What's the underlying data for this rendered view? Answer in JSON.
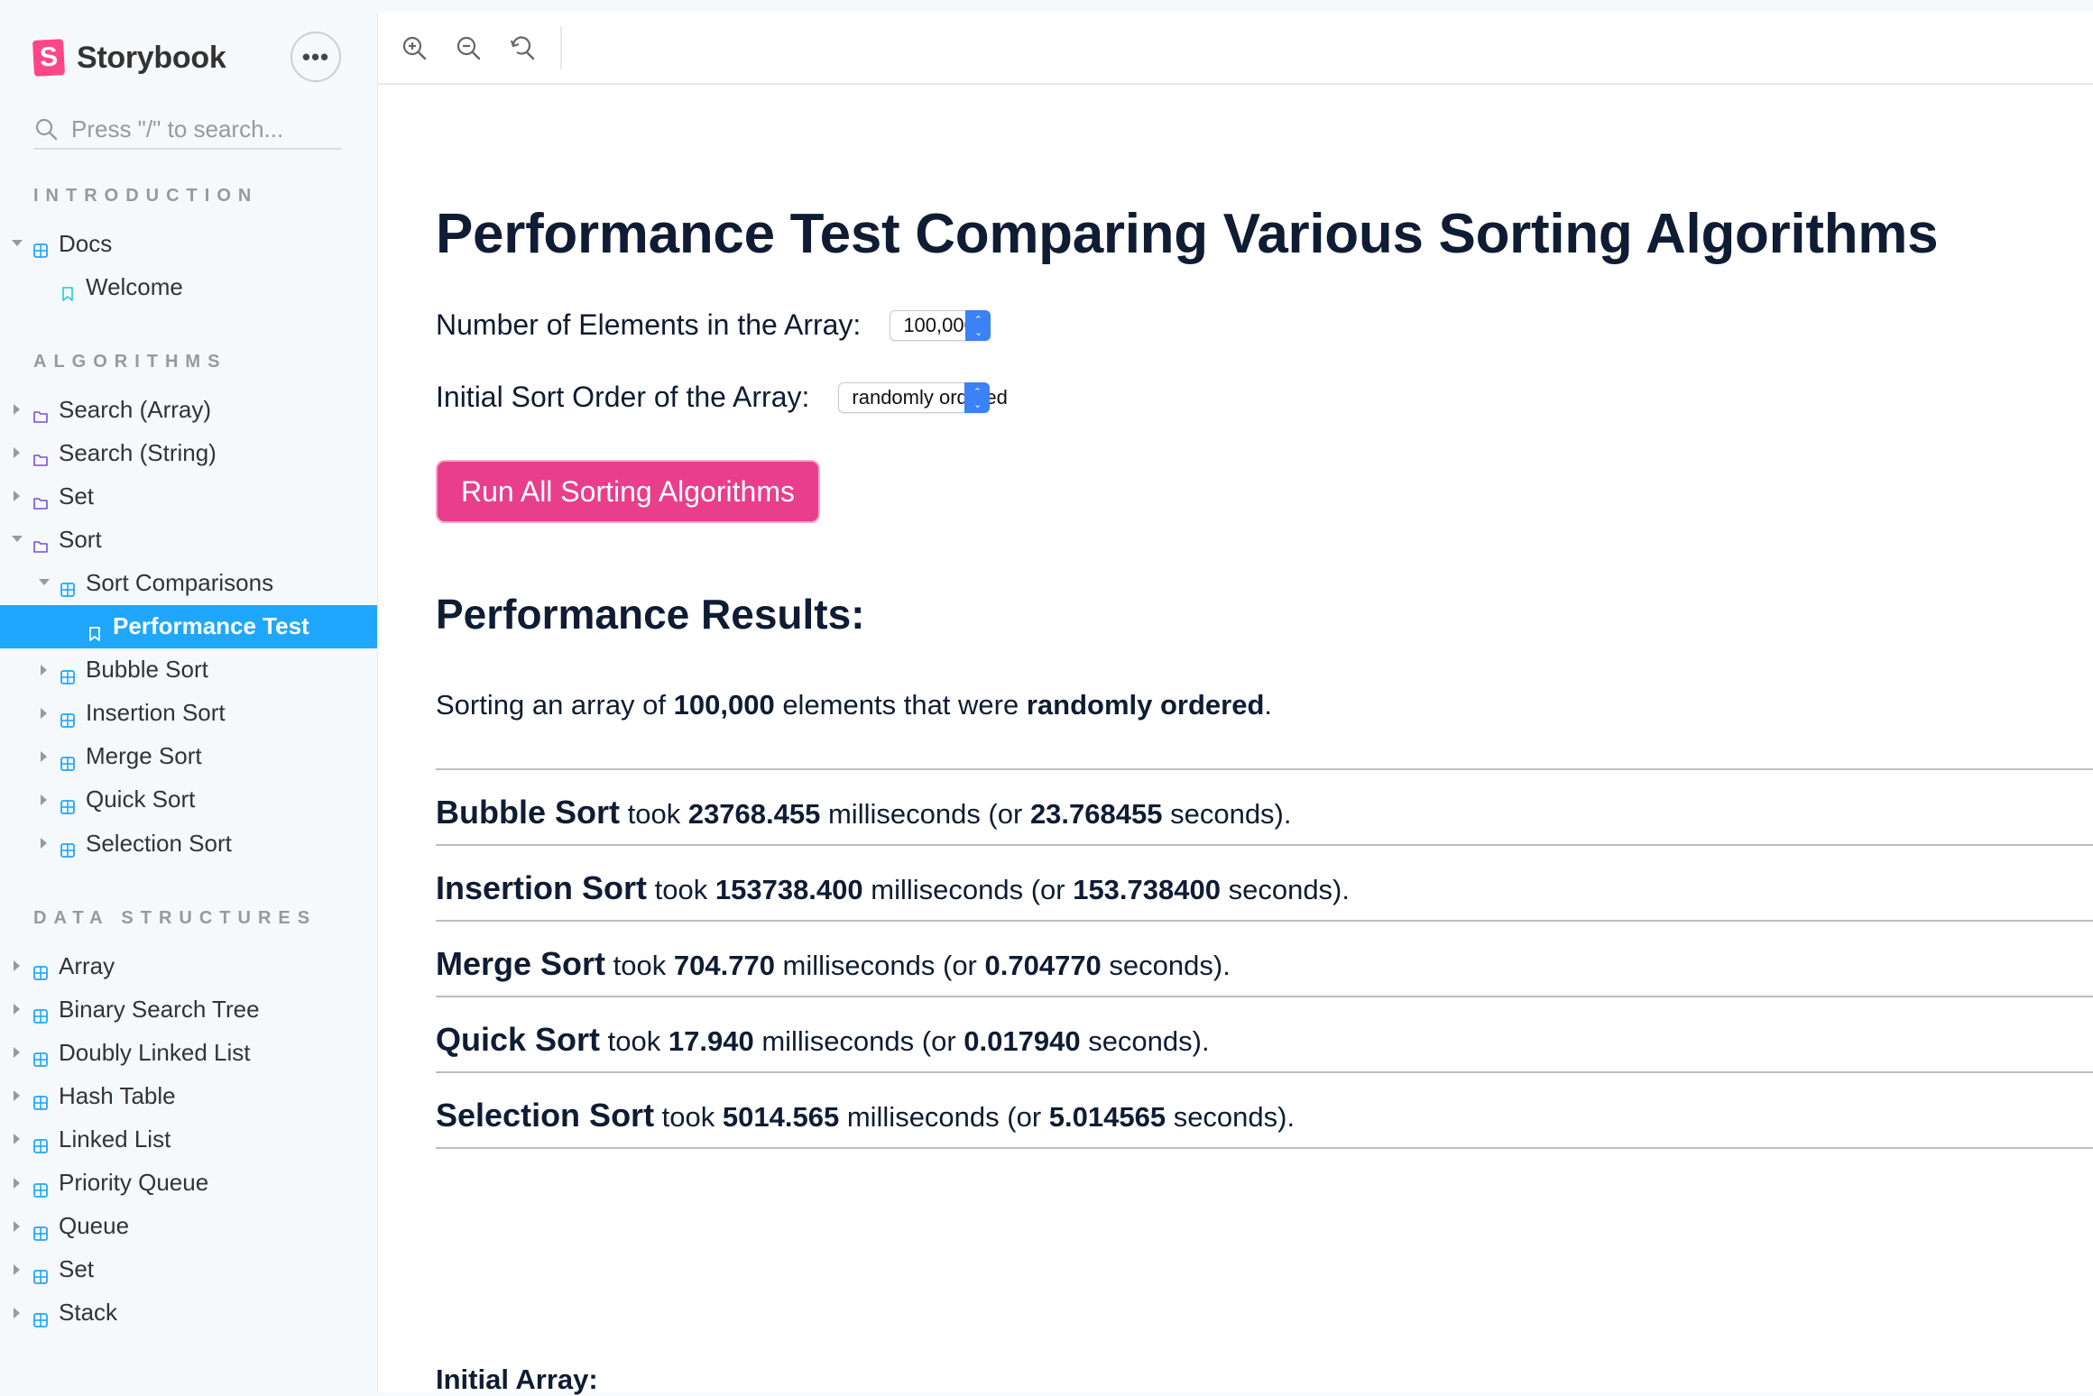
{
  "brand": {
    "logo_letter": "S",
    "name": "Storybook"
  },
  "sidebar": {
    "more_label": "•••",
    "search_placeholder": "Press \"/\" to search...",
    "sections": [
      {
        "heading": "INTRODUCTION",
        "items": [
          {
            "label": "Docs",
            "level": 0,
            "icon": "component-icon",
            "expanded": true
          },
          {
            "label": "Welcome",
            "level": 1,
            "icon": "bookmark-icon"
          }
        ]
      },
      {
        "heading": "ALGORITHMS",
        "items": [
          {
            "label": "Search (Array)",
            "level": 0,
            "icon": "folder-icon",
            "expanded": false
          },
          {
            "label": "Search (String)",
            "level": 0,
            "icon": "folder-icon",
            "expanded": false
          },
          {
            "label": "Set",
            "level": 0,
            "icon": "folder-icon",
            "expanded": false
          },
          {
            "label": "Sort",
            "level": 0,
            "icon": "folder-icon",
            "expanded": true
          },
          {
            "label": "Sort Comparisons",
            "level": 1,
            "icon": "component-icon",
            "expanded": true
          },
          {
            "label": "Performance Test",
            "level": 2,
            "icon": "bookmark-icon",
            "selected": true
          },
          {
            "label": "Bubble Sort",
            "level": 1,
            "icon": "component-icon",
            "expanded": false
          },
          {
            "label": "Insertion Sort",
            "level": 1,
            "icon": "component-icon",
            "expanded": false
          },
          {
            "label": "Merge Sort",
            "level": 1,
            "icon": "component-icon",
            "expanded": false
          },
          {
            "label": "Quick Sort",
            "level": 1,
            "icon": "component-icon",
            "expanded": false
          },
          {
            "label": "Selection Sort",
            "level": 1,
            "icon": "component-icon",
            "expanded": false
          }
        ]
      },
      {
        "heading": "DATA STRUCTURES",
        "items": [
          {
            "label": "Array",
            "level": 0,
            "icon": "component-icon",
            "expanded": false
          },
          {
            "label": "Binary Search Tree",
            "level": 0,
            "icon": "component-icon",
            "expanded": false
          },
          {
            "label": "Doubly Linked List",
            "level": 0,
            "icon": "component-icon",
            "expanded": false
          },
          {
            "label": "Hash Table",
            "level": 0,
            "icon": "component-icon",
            "expanded": false
          },
          {
            "label": "Linked List",
            "level": 0,
            "icon": "component-icon",
            "expanded": false
          },
          {
            "label": "Priority Queue",
            "level": 0,
            "icon": "component-icon",
            "expanded": false
          },
          {
            "label": "Queue",
            "level": 0,
            "icon": "component-icon",
            "expanded": false
          },
          {
            "label": "Set",
            "level": 0,
            "icon": "component-icon",
            "expanded": false
          },
          {
            "label": "Stack",
            "level": 0,
            "icon": "component-icon",
            "expanded": false
          }
        ]
      }
    ]
  },
  "toolbar": {
    "buttons": [
      "zoom-in-icon",
      "zoom-out-icon",
      "reset-zoom-icon"
    ]
  },
  "main": {
    "title": "Performance Test Comparing Various Sorting Algorithms",
    "elements_label": "Number of Elements in the Array:",
    "elements_value": "100,000",
    "order_label": "Initial Sort Order of the Array:",
    "order_value": "randomly ordered",
    "run_button": "Run All Sorting Algorithms",
    "results_heading": "Performance Results:",
    "summary": {
      "prefix": "Sorting an array of ",
      "count": "100,000",
      "middle": " elements that were ",
      "order": "randomly ordered",
      "suffix": "."
    },
    "results": [
      {
        "algo": "Bubble Sort",
        "ms": "23768.455",
        "sec": "23.768455"
      },
      {
        "algo": "Insertion Sort",
        "ms": "153738.400",
        "sec": "153.738400"
      },
      {
        "algo": "Merge Sort",
        "ms": "704.770",
        "sec": "0.704770"
      },
      {
        "algo": "Quick Sort",
        "ms": "17.940",
        "sec": "0.017940"
      },
      {
        "algo": "Selection Sort",
        "ms": "5014.565",
        "sec": "5.014565"
      }
    ],
    "took": " took ",
    "ms_open": " milliseconds (or ",
    "sec_close": " seconds).",
    "initial_heading": "Initial Array:"
  },
  "colors": {
    "accent": "#1ea7fd",
    "brand": "#ff4785",
    "button": "#e83e8c",
    "heading": "#0f1c33"
  }
}
